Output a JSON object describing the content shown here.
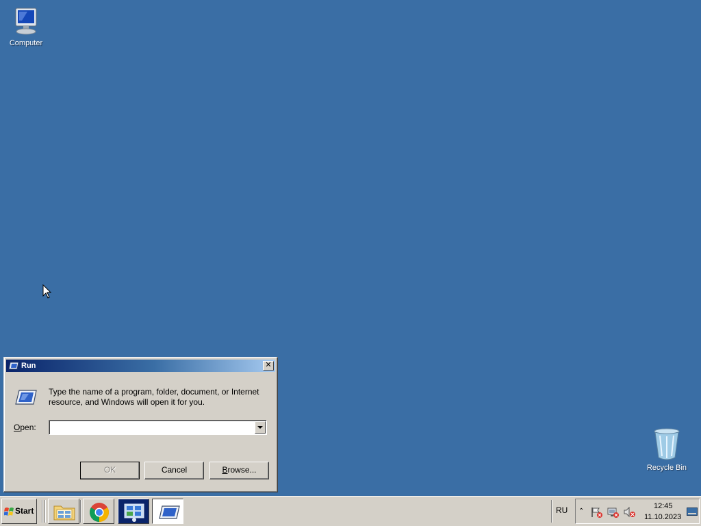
{
  "desktop": {
    "background_color": "#3a6ea5",
    "icons": [
      {
        "label": "Computer",
        "icon": "computer-icon"
      },
      {
        "label": "Recycle Bin",
        "icon": "recycle-bin-icon"
      }
    ]
  },
  "run_dialog": {
    "title": "Run",
    "description": "Type the name of a program, folder, document, or Internet resource, and Windows will open it for you.",
    "open_label_accel": "O",
    "open_label_rest": "pen:",
    "open_value": "",
    "buttons": {
      "ok": "OK",
      "cancel": "Cancel",
      "browse_accel": "B",
      "browse_rest": "rowse..."
    }
  },
  "taskbar": {
    "start_label": "Start",
    "pinned": [
      {
        "name": "file-explorer",
        "icon": "folder-icon"
      },
      {
        "name": "chrome",
        "icon": "chrome-icon"
      },
      {
        "name": "control-panel",
        "icon": "control-panel-icon"
      },
      {
        "name": "run",
        "icon": "run-icon",
        "active": true
      }
    ],
    "language": "RU",
    "clock": {
      "time": "12:45",
      "date": "11.10.2023"
    }
  }
}
